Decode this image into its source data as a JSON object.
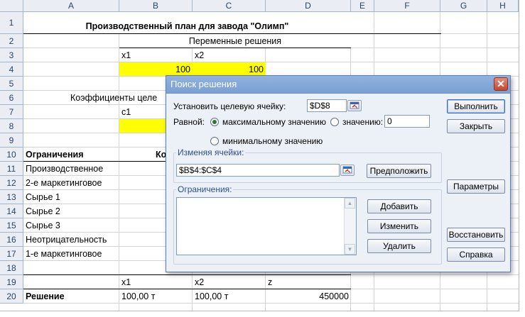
{
  "sheet": {
    "columns": [
      "A",
      "B",
      "C",
      "D",
      "E",
      "F",
      "G",
      "H"
    ],
    "rows": [
      "1",
      "2",
      "3",
      "4",
      "5",
      "6",
      "7",
      "8",
      "9",
      "10",
      "11",
      "12",
      "13",
      "14",
      "15",
      "16",
      "17",
      "18",
      "19",
      "20"
    ],
    "title": "Производственный план для завода \"Олимп\"",
    "subtitle_vars": "Переменные решения",
    "x1": "x1",
    "x2": "x2",
    "b4": "100",
    "c4": "100",
    "coeff_label": "Коэффициенты целе",
    "c1": "c1",
    "constraints_header": "Ограничения",
    "constraints_header_b": "Ко",
    "constraints": [
      "Производственное",
      "2-е маркетинговое",
      "Сырье 1",
      "Сырье 2",
      "Сырье 3",
      "Неотрицательность",
      "1-е маркетинговое"
    ],
    "r19_b": "x1",
    "r19_c": "x2",
    "r19_d": "z",
    "r20_a": "Решение",
    "r20_b": "100,00 т",
    "r20_c": "100,00 т",
    "r20_d": "450000"
  },
  "dialog": {
    "title": "Поиск решения",
    "close": "✕",
    "target_label": "Установить целевую ячейку:",
    "target_value": "$D$8",
    "equal_label": "Равной:",
    "opt_max": "максимальному значению",
    "opt_value": "значению:",
    "value_input": "0",
    "opt_min": "минимальному значению",
    "changing_label": "Изменяя ячейки:",
    "changing_value": "$B$4:$C$4",
    "guess_btn": "Предположить",
    "constraints_label": "Ограничения:",
    "add_btn": "Добавить",
    "change_btn": "Изменить",
    "delete_btn": "Удалить",
    "solve_btn": "Выполнить",
    "close_btn": "Закрыть",
    "options_btn": "Параметры",
    "reset_btn": "Восстановить",
    "help_btn": "Справка",
    "selected_option": "max"
  }
}
